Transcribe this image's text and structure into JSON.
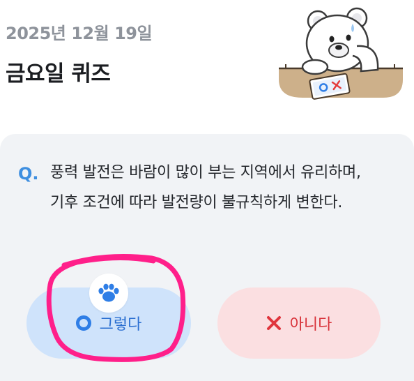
{
  "header": {
    "date": "2025년 12월 19일",
    "title": "금요일 퀴즈"
  },
  "mascot": {
    "icon": "bear-mascot-icon",
    "card_text": "OX"
  },
  "quiz": {
    "q_label": "Q.",
    "question": "풍력 발전은 바람이 많이 부는 지역에서 유리하며, 기후 조건에 따라 발전량이 불규칙하게 변한다.",
    "yes_label": "그렇다",
    "no_label": "아니다"
  },
  "colors": {
    "accent_blue": "#2f7ee6",
    "accent_red": "#d8333a",
    "annotation_pink": "#ff1f8a"
  }
}
